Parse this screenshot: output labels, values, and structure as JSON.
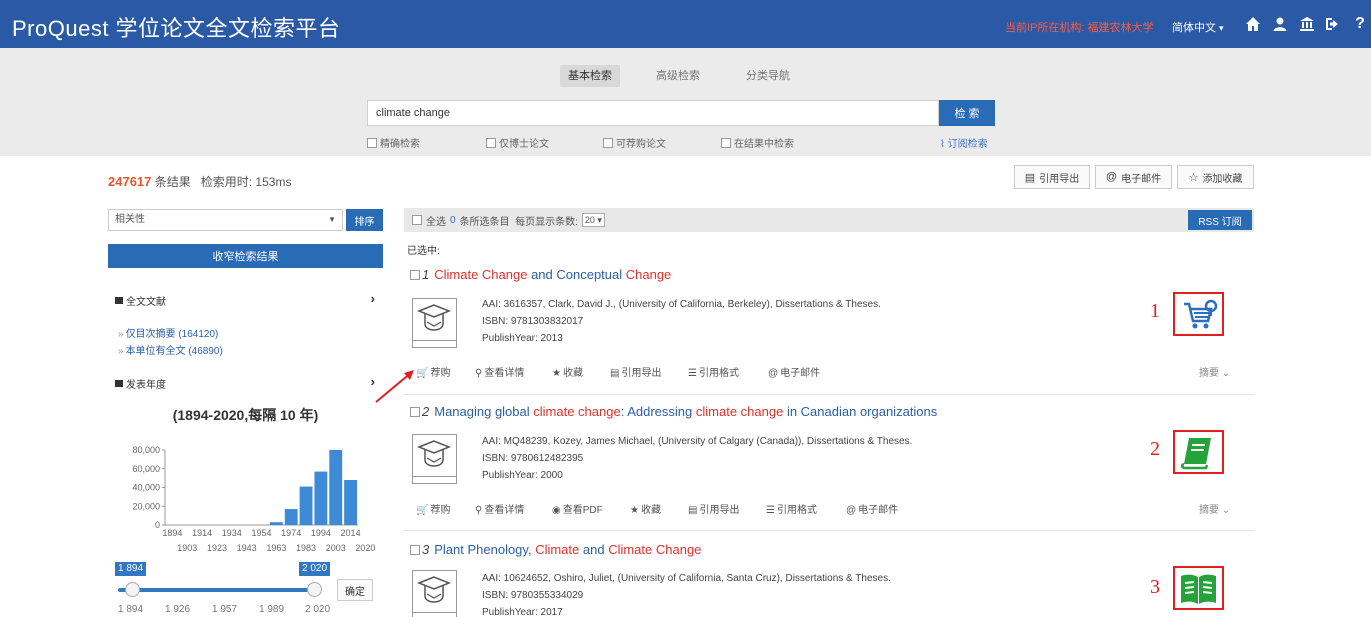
{
  "header": {
    "title": "ProQuest 学位论文全文检索平台",
    "institution": "当前IP所在机构: 福建农林大学",
    "language": "简体中文",
    "icons": [
      "home-icon",
      "user-icon",
      "institution-icon",
      "logout-icon",
      "help-icon"
    ]
  },
  "search": {
    "tabs": [
      "基本检索",
      "高级检索",
      "分类导航"
    ],
    "active_tab": "基本检索",
    "query": "climate change",
    "button": "检 索",
    "options": [
      "精确检索",
      "仅博士论文",
      "可荐购论文",
      "在结果中检索"
    ],
    "subscribe": "订阅检索"
  },
  "results_header": {
    "count": "247617",
    "count_label": "条结果",
    "time_label": "检索用时: 153ms",
    "buttons": [
      "引用导出",
      "电子邮件",
      "添加收藏"
    ]
  },
  "sidebar": {
    "sort_value": "相关性",
    "sort_button": "排序",
    "narrow_button": "收窄检索结果",
    "facet_fulltext": "全文文献",
    "facet_links": [
      "仅目次摘要",
      "(164120)",
      "本单位有全文",
      "(46890)"
    ],
    "facet_year": "发表年度",
    "histogram_title": "(1894-2020,每隔 10 年)",
    "slider_min_badge": "1 894",
    "slider_max_badge": "2 020",
    "confirm": "确定",
    "slider_labels": [
      "1 894",
      "1 926",
      "1 957",
      "1 989",
      "2 020"
    ]
  },
  "chart_data": {
    "type": "bar",
    "title": "(1894-2020,每隔 10 年)",
    "categories": [
      "1894",
      "1903",
      "1914",
      "1923",
      "1934",
      "1943",
      "1954",
      "1963",
      "1974",
      "1983",
      "1994",
      "2003",
      "2014"
    ],
    "values": [
      0,
      0,
      0,
      0,
      0,
      0,
      0,
      3000,
      17000,
      41000,
      57000,
      80000,
      48000
    ],
    "ylim": [
      0,
      80000
    ],
    "yticks": [
      "80,000",
      "60,000",
      "40,000",
      "20,000",
      "0"
    ],
    "xticks_top": [
      "1894",
      "1914",
      "1934",
      "1954",
      "1974",
      "1994",
      "2014"
    ],
    "xticks_bottom": [
      "1903",
      "1923",
      "1943",
      "1963",
      "1983",
      "2003",
      "2020"
    ],
    "color": "#3d8ad6"
  },
  "list": {
    "select_all": "全选",
    "selected_count": "0",
    "selected_text": "条所选条目",
    "per_page_label": "每页显示条数:",
    "per_page": "20",
    "rss": "RSS 订阅",
    "selected_label": "已选中:",
    "abstract_label": "摘要"
  },
  "results": [
    {
      "index": "1",
      "title_parts": [
        [
          "Climate Change",
          true
        ],
        [
          " and Conceptual ",
          false
        ],
        [
          "Change",
          true
        ]
      ],
      "aai": "AAI: 3616357, Clark, David J., (University of California, Berkeley), Dissertations & Theses.",
      "isbn": "ISBN: 9781303832017",
      "year": "PublishYear: 2013",
      "actions": [
        "荐购",
        "查看详情",
        "收藏",
        "引用导出",
        "引用格式",
        "电子邮件"
      ],
      "annotation": "1",
      "annotation_icon": "cart-icon"
    },
    {
      "index": "2",
      "title_parts": [
        [
          "Managing global ",
          false
        ],
        [
          "climate change",
          true
        ],
        [
          ": Addressing ",
          false
        ],
        [
          "climate change",
          true
        ],
        [
          " in Canadian organizations",
          false
        ]
      ],
      "aai": "AAI: MQ48239, Kozey, James Michael, (University of Calgary (Canada)), Dissertations & Theses.",
      "isbn": "ISBN: 9780612482395",
      "year": "PublishYear: 2000",
      "actions": [
        "荐购",
        "查看详情",
        "查看PDF",
        "收藏",
        "引用导出",
        "引用格式",
        "电子邮件"
      ],
      "annotation": "2",
      "annotation_icon": "closed-book-icon"
    },
    {
      "index": "3",
      "title_parts": [
        [
          "Plant Phenology, ",
          false
        ],
        [
          "Climate",
          true
        ],
        [
          " and ",
          false
        ],
        [
          "Climate Change",
          true
        ]
      ],
      "aai": "AAI: 10624652, Oshiro, Juliet, (University of California, Santa Cruz), Dissertations & Theses.",
      "isbn": "ISBN: 9780355334029",
      "year": "PublishYear: 2017",
      "actions": [],
      "annotation": "3",
      "annotation_icon": "open-book-icon"
    }
  ],
  "colors": {
    "header": "#2a5aa6",
    "primary_button": "#2a6bb5",
    "highlight": "#e0312a",
    "annotation": "#e02020",
    "green_icon": "#25a23a"
  }
}
